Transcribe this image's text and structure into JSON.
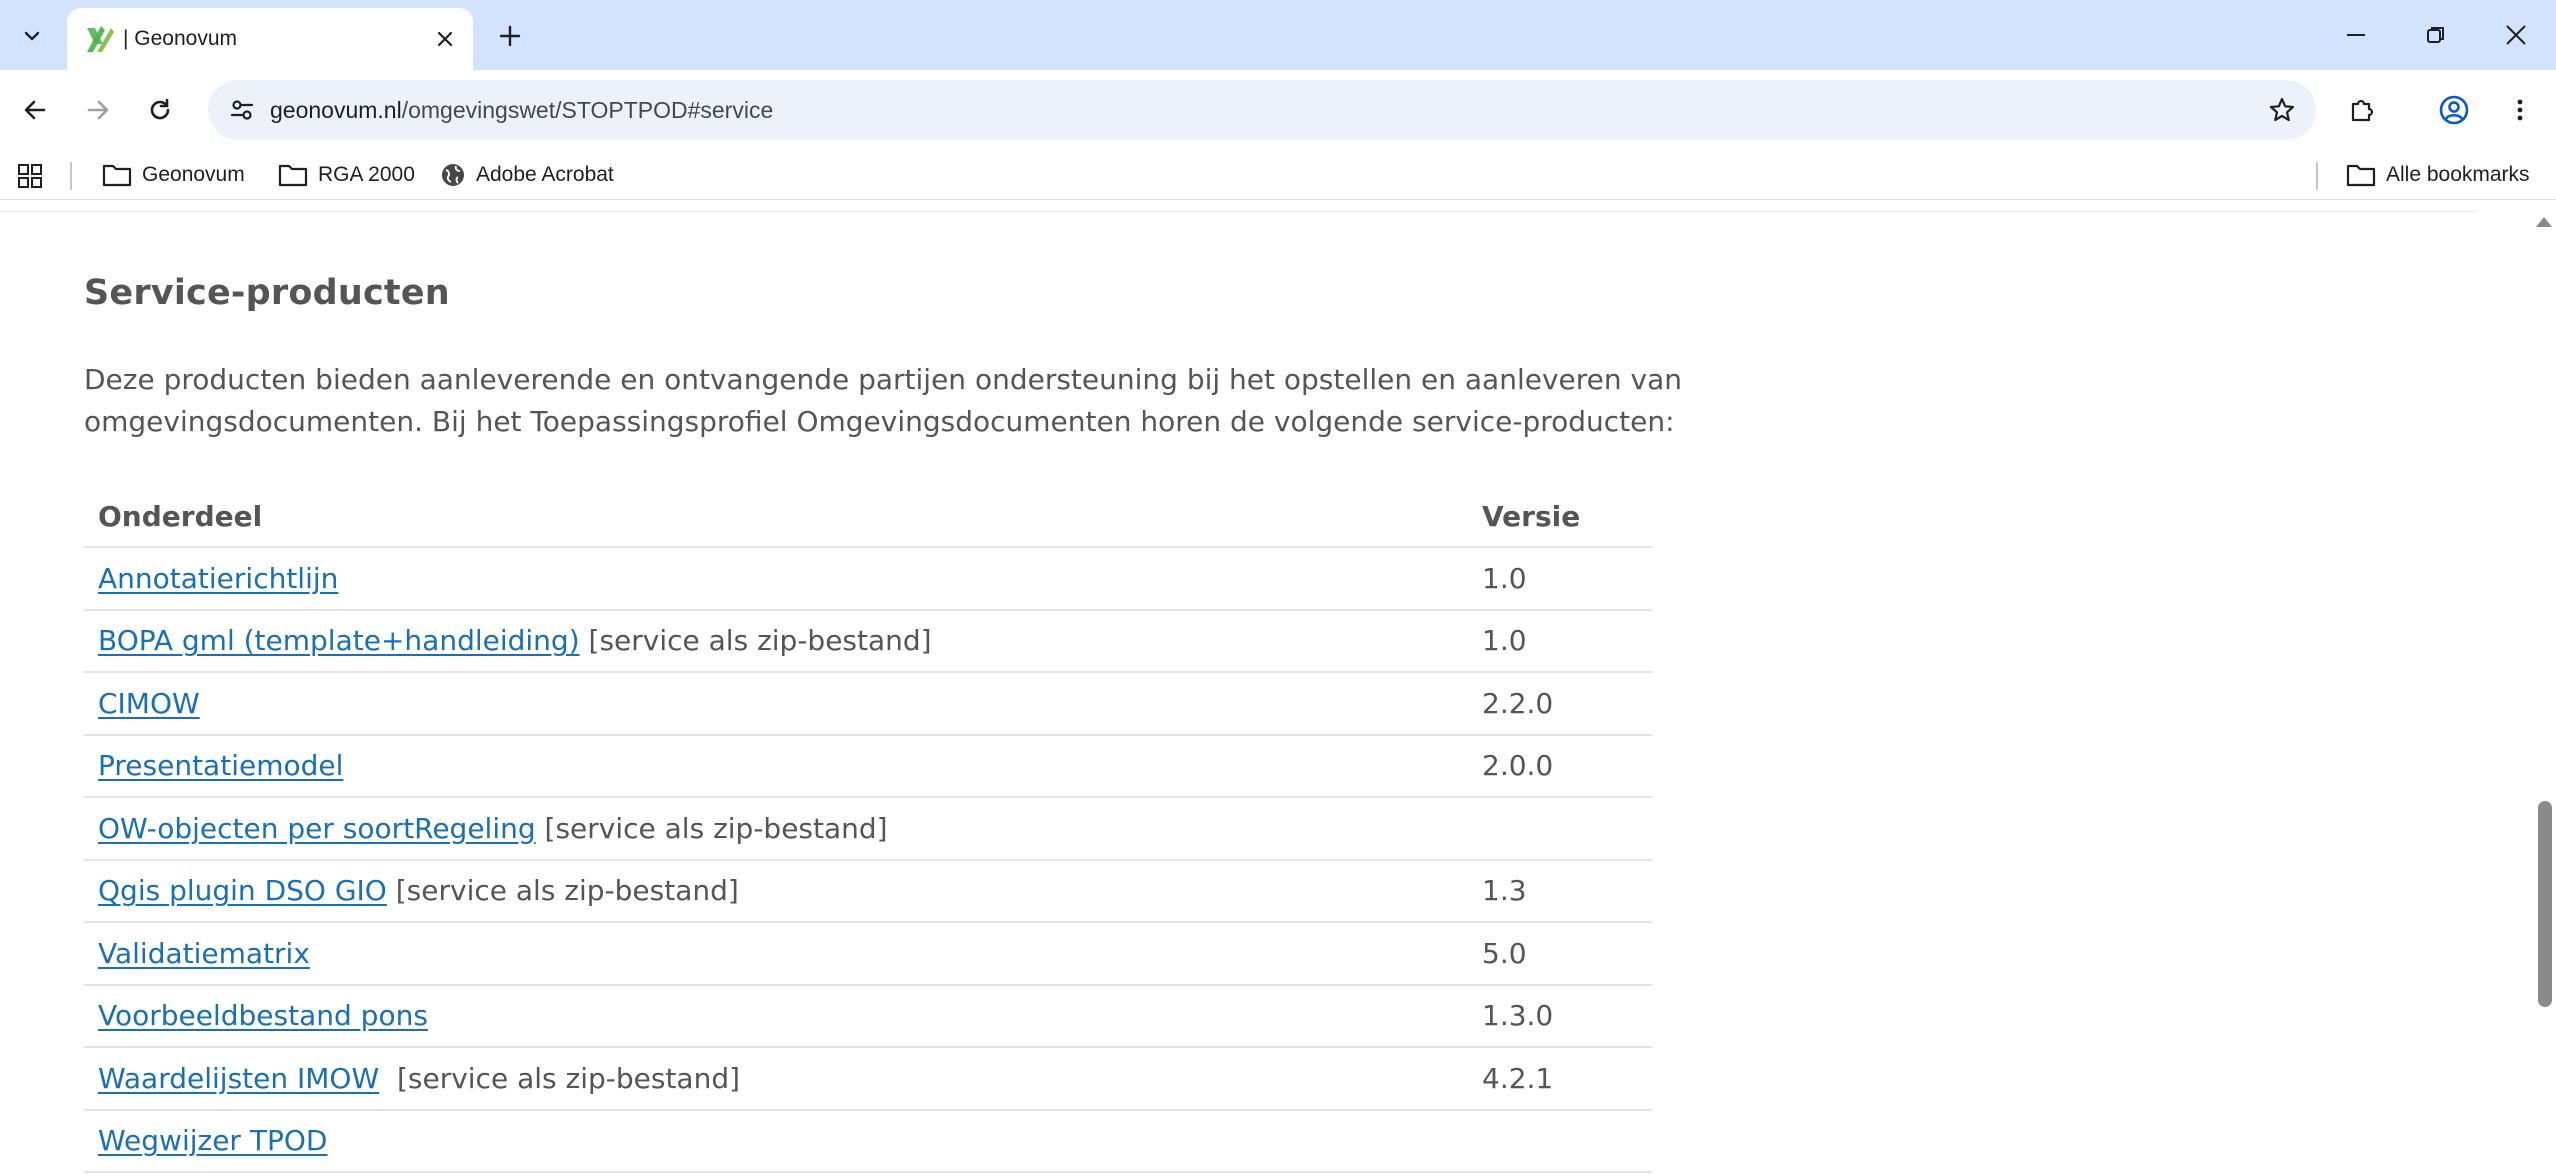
{
  "browser": {
    "tab_title": "| Geonovum",
    "url_host": "geonovum.nl",
    "url_path": "/omgevingswet/STOPTPOD#service",
    "bookmarks": [
      "Geonovum",
      "RGA 2000",
      "Adobe Acrobat"
    ],
    "all_bookmarks": "Alle bookmarks",
    "accent_color": "#d3e3fd"
  },
  "page": {
    "section_title": "Service-producten",
    "intro": "Deze producten bieden aanleverende en ontvangende partijen ondersteuning bij het opstellen en aanleveren van omgevingsdocumenten. Bij het Toepassingsprofiel Omgevingsdocumenten horen de volgende service-producten:",
    "table": {
      "headers": [
        "Onderdeel",
        "Versie"
      ],
      "rows": [
        {
          "link": "Annotatierichtlijn",
          "suffix": "",
          "version": "1.0"
        },
        {
          "link": "BOPA gml (template+handleiding)",
          "suffix": " [service als zip-bestand]",
          "version": "1.0"
        },
        {
          "link": "CIMOW",
          "suffix": "",
          "version": "2.2.0"
        },
        {
          "link": "Presentatiemodel",
          "suffix": "",
          "version": "2.0.0"
        },
        {
          "link": "OW-objecten per soortRegeling",
          "suffix": " [service als zip-bestand]",
          "version": ""
        },
        {
          "link": "Qgis plugin DSO GIO",
          "suffix": " [service als zip-bestand]",
          "version": "1.3"
        },
        {
          "link": "Validatiematrix",
          "suffix": "",
          "version": "5.0"
        },
        {
          "link": "Voorbeeldbestand pons",
          "suffix": "",
          "version": "1.3.0"
        },
        {
          "link": "Waardelijsten IMOW",
          "suffix": "  [service als zip-bestand]",
          "version": "4.2.1"
        },
        {
          "link": "Wegwijzer TPOD",
          "suffix": "",
          "version": ""
        }
      ]
    },
    "link_color": "#1a6fb5",
    "text_color": "#555555"
  }
}
